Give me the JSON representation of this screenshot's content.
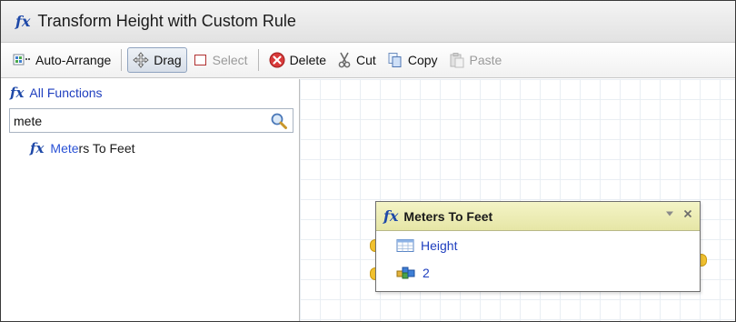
{
  "window": {
    "title": "Transform Height with Custom Rule",
    "title_icon": "function-icon"
  },
  "toolbar": {
    "auto_arrange": "Auto-Arrange",
    "drag": "Drag",
    "select": "Select",
    "delete": "Delete",
    "cut": "Cut",
    "copy": "Copy",
    "paste": "Paste",
    "drag_pressed": true,
    "select_disabled": true,
    "paste_disabled": true
  },
  "sidebar": {
    "all_functions_label": "All Functions",
    "search": {
      "value": "mete",
      "placeholder": ""
    },
    "results": [
      {
        "match": "Mete",
        "rest": "rs To Feet"
      }
    ]
  },
  "node": {
    "title": "Meters To Feet",
    "inputs": [
      {
        "label": "Height",
        "icon": "table-field-icon"
      },
      {
        "label": "2",
        "icon": "constant-blocks-icon"
      }
    ]
  },
  "colors": {
    "accent": "#1f49a8",
    "node_header": "#eded b4",
    "port": "#f2c230",
    "link_text": "#1f3fbf"
  }
}
